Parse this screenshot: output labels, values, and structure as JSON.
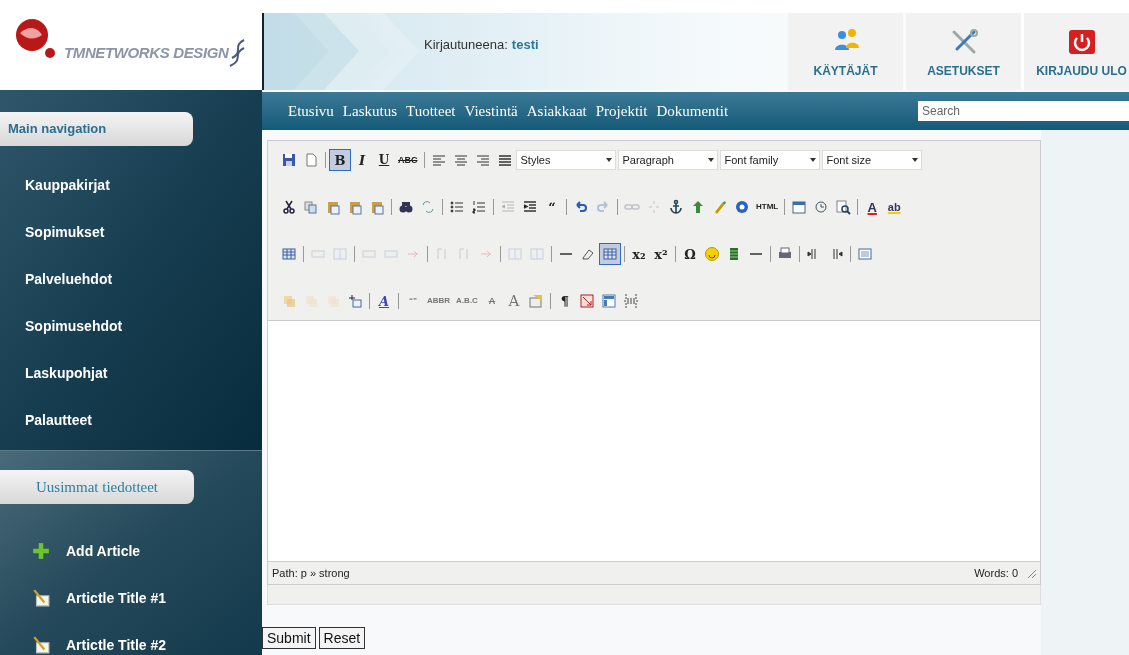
{
  "header": {
    "logo_text": "TMNETWORKS DESIGN",
    "login_label": "Kirjautuneena:",
    "login_user": "testi",
    "tiles": [
      "KÄYTÄJÄT",
      "ASETUKSET",
      "KIRJAUDU ULO"
    ]
  },
  "sidebar": {
    "main_heading": "Main navigation",
    "items": [
      "Kauppakirjat",
      "Sopimukset",
      "Palveluehdot",
      "Sopimusehdot",
      "Laskupohjat",
      "Palautteet"
    ],
    "news_heading": "Uusimmat tiedotteet",
    "news": [
      {
        "kind": "add",
        "label": "Add Article"
      },
      {
        "kind": "article",
        "label": "Artictle Title #1"
      },
      {
        "kind": "article",
        "label": "Artictle Title #2"
      }
    ]
  },
  "topnav": {
    "links": [
      "Etusivu",
      "Laskutus",
      "Tuotteet",
      "Viestintä",
      "Asiakkaat",
      "Projektit",
      "Dokumentit"
    ],
    "search": {
      "placeholder": "Search"
    }
  },
  "editor": {
    "toolbar_rows": [
      [
        {
          "kind": "button"
        },
        {
          "kind": "button"
        },
        {
          "kind": "sep"
        },
        {
          "kind": "button",
          "glyph": "B",
          "active": true
        },
        {
          "kind": "button",
          "glyph": "I"
        },
        {
          "kind": "button",
          "glyph": "U"
        },
        {
          "kind": "button",
          "glyph": "ABC"
        },
        {
          "kind": "sep"
        },
        {
          "kind": "button"
        },
        {
          "kind": "button"
        },
        {
          "kind": "button"
        },
        {
          "kind": "button"
        },
        {
          "kind": "select",
          "label": "Styles"
        },
        {
          "kind": "select",
          "label": "Paragraph"
        },
        {
          "kind": "select",
          "label": "Font family"
        },
        {
          "kind": "select",
          "label": "Font size"
        }
      ],
      [
        {
          "kind": "button"
        },
        {
          "kind": "button"
        },
        {
          "kind": "button"
        },
        {
          "kind": "button"
        },
        {
          "kind": "button"
        },
        {
          "kind": "sep"
        },
        {
          "kind": "button"
        },
        {
          "kind": "button"
        },
        {
          "kind": "sep"
        },
        {
          "kind": "button"
        },
        {
          "kind": "button"
        },
        {
          "kind": "sep"
        },
        {
          "kind": "button",
          "disabled": true
        },
        {
          "kind": "button"
        },
        {
          "kind": "button",
          "glyph": "“"
        },
        {
          "kind": "sep"
        },
        {
          "kind": "button"
        },
        {
          "kind": "button",
          "disabled": true
        },
        {
          "kind": "sep"
        },
        {
          "kind": "button",
          "disabled": true
        },
        {
          "kind": "button",
          "disabled": true
        },
        {
          "kind": "button"
        },
        {
          "kind": "button"
        },
        {
          "kind": "button"
        },
        {
          "kind": "button"
        },
        {
          "kind": "button",
          "glyph": "HTML"
        },
        {
          "kind": "sep"
        },
        {
          "kind": "button"
        },
        {
          "kind": "button"
        },
        {
          "kind": "button"
        },
        {
          "kind": "sep"
        },
        {
          "kind": "button",
          "glyph": "A"
        },
        {
          "kind": "button",
          "glyph": "ab"
        }
      ],
      [
        {
          "kind": "button"
        },
        {
          "kind": "sep"
        },
        {
          "kind": "button",
          "disabled": true
        },
        {
          "kind": "button",
          "disabled": true
        },
        {
          "kind": "sep"
        },
        {
          "kind": "button",
          "disabled": true
        },
        {
          "kind": "button",
          "disabled": true
        },
        {
          "kind": "button",
          "disabled": true
        },
        {
          "kind": "sep"
        },
        {
          "kind": "button",
          "disabled": true
        },
        {
          "kind": "button",
          "disabled": true
        },
        {
          "kind": "button",
          "disabled": true
        },
        {
          "kind": "sep"
        },
        {
          "kind": "button",
          "disabled": true
        },
        {
          "kind": "button",
          "disabled": true
        },
        {
          "kind": "sep"
        },
        {
          "kind": "button"
        },
        {
          "kind": "button"
        },
        {
          "kind": "button",
          "active": true
        },
        {
          "kind": "sep"
        },
        {
          "kind": "button",
          "glyph": "x₂"
        },
        {
          "kind": "button",
          "glyph": "x²"
        },
        {
          "kind": "sep"
        },
        {
          "kind": "button",
          "glyph": "Ω"
        },
        {
          "kind": "button"
        },
        {
          "kind": "button"
        },
        {
          "kind": "button"
        },
        {
          "kind": "sep"
        },
        {
          "kind": "button"
        },
        {
          "kind": "sep"
        },
        {
          "kind": "button"
        },
        {
          "kind": "button"
        },
        {
          "kind": "sep"
        },
        {
          "kind": "button"
        }
      ],
      [
        {
          "kind": "button"
        },
        {
          "kind": "button",
          "disabled": true
        },
        {
          "kind": "button",
          "disabled": true
        },
        {
          "kind": "button"
        },
        {
          "kind": "sep"
        },
        {
          "kind": "button",
          "glyph": "A"
        },
        {
          "kind": "sep"
        },
        {
          "kind": "button",
          "glyph": "“”",
          "disabled": true
        },
        {
          "kind": "button",
          "glyph": "ABBR",
          "disabled": true
        },
        {
          "kind": "button",
          "glyph": "A.B.C",
          "disabled": true
        },
        {
          "kind": "button",
          "glyph": "A",
          "disabled": true
        },
        {
          "kind": "button",
          "glyph": "A",
          "disabled": true
        },
        {
          "kind": "button"
        },
        {
          "kind": "sep"
        },
        {
          "kind": "button",
          "glyph": "¶"
        },
        {
          "kind": "button"
        },
        {
          "kind": "button"
        },
        {
          "kind": "button"
        }
      ]
    ],
    "path_label": "Path: p » strong",
    "words": "Words: 0"
  },
  "buttons": [
    "Submit",
    "Reset"
  ]
}
